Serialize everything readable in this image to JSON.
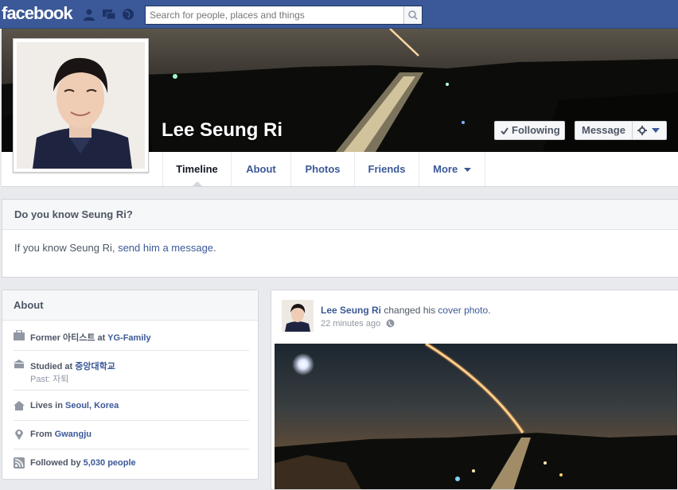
{
  "topbar": {
    "logo": "facebook",
    "search_placeholder": "Search for people, places and things"
  },
  "profile": {
    "name": "Lee Seung Ri",
    "following_label": "Following",
    "message_label": "Message"
  },
  "tabs": [
    {
      "label": "Timeline"
    },
    {
      "label": "About"
    },
    {
      "label": "Photos"
    },
    {
      "label": "Friends"
    },
    {
      "label": "More"
    }
  ],
  "know_box": {
    "title": "Do you know Seung Ri?",
    "text_before": "If you know Seung Ri, ",
    "link": "send him a message",
    "text_after": "."
  },
  "about": {
    "title": "About",
    "work": {
      "prefix": "Former ",
      "role": "아티스트",
      "at": " at ",
      "company": "YG-Family"
    },
    "education": {
      "prefix": "Studied at ",
      "school": "중앙대학교",
      "past": "Past: 자퇴"
    },
    "lives": {
      "prefix": "Lives in ",
      "place": "Seoul, Korea"
    },
    "from": {
      "prefix": "From ",
      "place": "Gwangju"
    },
    "followed": {
      "prefix": "Followed by ",
      "count": "5,030 people"
    }
  },
  "post": {
    "author": "Lee Seung Ri",
    "action": " changed his ",
    "object": "cover photo",
    "end": ".",
    "time": "22 minutes ago"
  },
  "colors": {
    "brand": "#3b5998",
    "background": "#e9eaed"
  },
  "icons": [
    "friend-requests-icon",
    "messages-icon",
    "notifications-icon",
    "search-icon",
    "check-icon",
    "gear-icon",
    "caret-down-icon",
    "briefcase-icon",
    "education-icon",
    "home-icon",
    "location-pin-icon",
    "rss-icon",
    "globe-icon"
  ]
}
